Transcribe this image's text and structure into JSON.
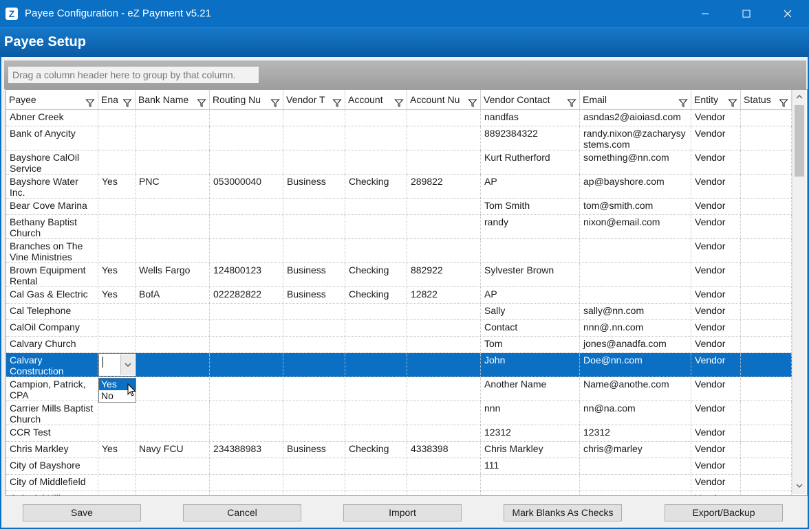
{
  "window": {
    "title": "Payee Configuration - eZ Payment v5.21",
    "app_icon": "Z"
  },
  "header": {
    "title": "Payee Setup"
  },
  "group_panel": {
    "hint": "Drag a column header here to group by that column."
  },
  "columns": [
    "Payee",
    "Ena",
    "Bank Name",
    "Routing Nu",
    "Vendor T",
    "Account",
    "Account Nu",
    "Vendor Contact",
    "Email",
    "Entity",
    "Status"
  ],
  "rows": [
    {
      "payee": "Abner Creek",
      "enabled": "",
      "bank": "",
      "routing": "",
      "vendor_type": "",
      "account": "",
      "account_no": "",
      "contact": "nandfas",
      "email": "asndas2@aioiasd.com",
      "entity": "Vendor",
      "status": ""
    },
    {
      "payee": "Bank of Anycity",
      "enabled": "",
      "bank": "",
      "routing": "",
      "vendor_type": "",
      "account": "",
      "account_no": "",
      "contact": "8892384322",
      "email": "randy.nixon@zacharysy stems.com",
      "entity": "Vendor",
      "status": ""
    },
    {
      "payee": "Bayshore CalOil Service",
      "enabled": "",
      "bank": "",
      "routing": "",
      "vendor_type": "",
      "account": "",
      "account_no": "",
      "contact": "Kurt Rutherford",
      "email": "something@nn.com",
      "entity": "Vendor",
      "status": ""
    },
    {
      "payee": "Bayshore Water Inc.",
      "enabled": "Yes",
      "bank": "PNC",
      "routing": "053000040",
      "vendor_type": "Business",
      "account": "Checking",
      "account_no": "289822",
      "contact": "AP",
      "email": "ap@bayshore.com",
      "entity": "Vendor",
      "status": ""
    },
    {
      "payee": "Bear Cove Marina",
      "enabled": "",
      "bank": "",
      "routing": "",
      "vendor_type": "",
      "account": "",
      "account_no": "",
      "contact": "Tom Smith",
      "email": "tom@smith.com",
      "entity": "Vendor",
      "status": ""
    },
    {
      "payee": "Bethany Baptist Church",
      "enabled": "",
      "bank": "",
      "routing": "",
      "vendor_type": "",
      "account": "",
      "account_no": "",
      "contact": "randy",
      "email": "nixon@email.com",
      "entity": "Vendor",
      "status": ""
    },
    {
      "payee": "Branches on The Vine Ministries",
      "enabled": "",
      "bank": "",
      "routing": "",
      "vendor_type": "",
      "account": "",
      "account_no": "",
      "contact": "",
      "email": "",
      "entity": "Vendor",
      "status": ""
    },
    {
      "payee": "Brown Equipment Rental",
      "enabled": "Yes",
      "bank": "Wells Fargo",
      "routing": "124800123",
      "vendor_type": "Business",
      "account": "Checking",
      "account_no": "882922",
      "contact": "Sylvester Brown",
      "email": "",
      "entity": "Vendor",
      "status": ""
    },
    {
      "payee": "Cal Gas & Electric",
      "enabled": "Yes",
      "bank": "BofA",
      "routing": "022282822",
      "vendor_type": "Business",
      "account": "Checking",
      "account_no": "12822",
      "contact": "AP",
      "email": "",
      "entity": "Vendor",
      "status": ""
    },
    {
      "payee": "Cal Telephone",
      "enabled": "",
      "bank": "",
      "routing": "",
      "vendor_type": "",
      "account": "",
      "account_no": "",
      "contact": "Sally",
      "email": "sally@nn.com",
      "entity": "Vendor",
      "status": ""
    },
    {
      "payee": "CalOil Company",
      "enabled": "",
      "bank": "",
      "routing": "",
      "vendor_type": "",
      "account": "",
      "account_no": "",
      "contact": "Contact",
      "email": "nnn@.nn.com",
      "entity": "Vendor",
      "status": ""
    },
    {
      "payee": "Calvary Church",
      "enabled": "",
      "bank": "",
      "routing": "",
      "vendor_type": "",
      "account": "",
      "account_no": "",
      "contact": "Tom",
      "email": "jones@anadfa.com",
      "entity": "Vendor",
      "status": ""
    },
    {
      "payee": "Calvary Construction",
      "enabled": "",
      "bank": "",
      "routing": "",
      "vendor_type": "",
      "account": "",
      "account_no": "",
      "contact": "John",
      "email": "Doe@nn.com",
      "entity": "Vendor",
      "status": ""
    },
    {
      "payee": "Campion, Patrick, CPA",
      "enabled": "",
      "bank": "",
      "routing": "",
      "vendor_type": "",
      "account": "",
      "account_no": "",
      "contact": "Another Name",
      "email": "Name@anothe.com",
      "entity": "Vendor",
      "status": ""
    },
    {
      "payee": "Carrier Mills Baptist Church",
      "enabled": "",
      "bank": "",
      "routing": "",
      "vendor_type": "",
      "account": "",
      "account_no": "",
      "contact": "nnn",
      "email": "nn@na.com",
      "entity": "Vendor",
      "status": ""
    },
    {
      "payee": "CCR Test",
      "enabled": "",
      "bank": "",
      "routing": "",
      "vendor_type": "",
      "account": "",
      "account_no": "",
      "contact": "12312",
      "email": "12312",
      "entity": "Vendor",
      "status": ""
    },
    {
      "payee": "Chris Markley",
      "enabled": "Yes",
      "bank": "Navy FCU",
      "routing": "234388983",
      "vendor_type": "Business",
      "account": "Checking",
      "account_no": "4338398",
      "contact": "Chris Markley",
      "email": "chris@marley",
      "entity": "Vendor",
      "status": ""
    },
    {
      "payee": "City of Bayshore",
      "enabled": "",
      "bank": "",
      "routing": "",
      "vendor_type": "",
      "account": "",
      "account_no": "",
      "contact": "111",
      "email": "",
      "entity": "Vendor",
      "status": ""
    },
    {
      "payee": "City of Middlefield",
      "enabled": "",
      "bank": "",
      "routing": "",
      "vendor_type": "",
      "account": "",
      "account_no": "",
      "contact": "",
      "email": "",
      "entity": "Vendor",
      "status": ""
    },
    {
      "payee": "Colonial Hills",
      "enabled": "",
      "bank": "",
      "routing": "",
      "vendor_type": "",
      "account": "",
      "account_no": "",
      "contact": "",
      "email": "",
      "entity": "Vendor",
      "status": ""
    }
  ],
  "selected_row": "Calvary Construction",
  "enabled_dropdown": {
    "value": "",
    "options": [
      "Yes",
      "No"
    ],
    "highlighted": "Yes"
  },
  "buttons": {
    "save": "Save",
    "cancel": "Cancel",
    "import": "Import",
    "mark_blanks": "Mark Blanks As Checks",
    "export": "Export/Backup"
  },
  "colors": {
    "accent": "#0b6fc4",
    "selection": "#0b6fc4"
  }
}
